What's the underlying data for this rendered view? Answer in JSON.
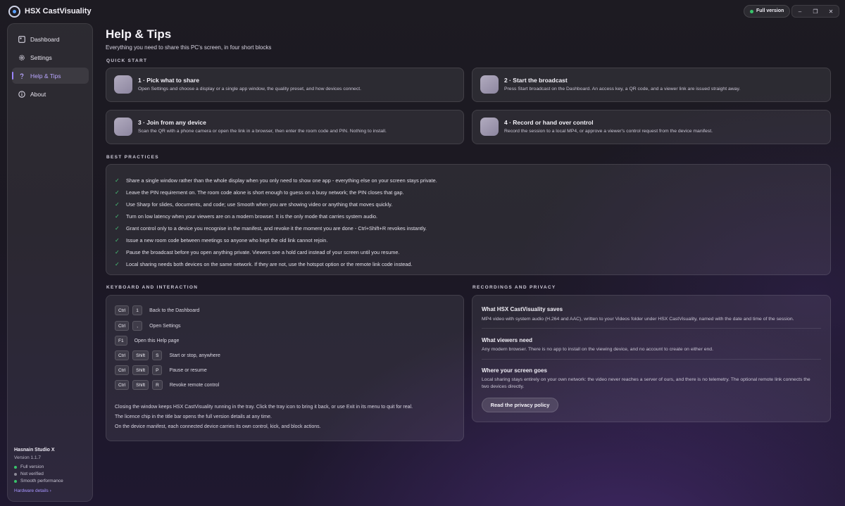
{
  "app": {
    "title": "HSX CastVisuality",
    "license_chip": "Full version"
  },
  "window_controls": {
    "minimize": "–",
    "restore": "❐",
    "close": "✕"
  },
  "sidebar": {
    "items": [
      {
        "label": "Dashboard",
        "icon": "dashboard-icon"
      },
      {
        "label": "Settings",
        "icon": "gear-icon"
      },
      {
        "label": "Help & Tips",
        "icon": "question-icon",
        "active": true
      },
      {
        "label": "About",
        "icon": "info-icon"
      }
    ],
    "footer": {
      "studio": "Hasnain Studio X",
      "version": "Version 1.1.7",
      "statuses": [
        {
          "label": "Full version",
          "color": "#39c46b"
        },
        {
          "label": "Not verified",
          "color": "#8d8a97"
        },
        {
          "label": "Smooth performance",
          "color": "#39c46b"
        }
      ],
      "hardware_link": "Hardware details ›"
    }
  },
  "page": {
    "title": "Help & Tips",
    "subtitle": "Everything you need to share this PC's screen, in four short blocks"
  },
  "quick_start": {
    "label": "QUICK START",
    "steps": [
      {
        "title": "1 · Pick what to share",
        "desc": "Open Settings and choose a display or a single app window, the quality preset, and how devices connect."
      },
      {
        "title": "2 · Start the broadcast",
        "desc": "Press Start broadcast on the Dashboard. An access key, a QR code, and a viewer link are issued straight away."
      },
      {
        "title": "3 · Join from any device",
        "desc": "Scan the QR with a phone camera or open the link in a browser, then enter the room code and PIN. Nothing to install."
      },
      {
        "title": "4 · Record or hand over control",
        "desc": "Record the session to a local MP4, or approve a viewer's control request from the device manifest."
      }
    ]
  },
  "best_practices": {
    "label": "BEST PRACTICES",
    "items": [
      "Share a single window rather than the whole display when you only need to show one app - everything else on your screen stays private.",
      "Leave the PIN requirement on. The room code alone is short enough to guess on a busy network; the PIN closes that gap.",
      "Use Sharp for slides, documents, and code; use Smooth when you are showing video or anything that moves quickly.",
      "Turn on low latency when your viewers are on a modern browser. It is the only mode that carries system audio.",
      "Grant control only to a device you recognise in the manifest, and revoke it the moment you are done - Ctrl+Shift+R revokes instantly.",
      "Issue a new room code between meetings so anyone who kept the old link cannot rejoin.",
      "Pause the broadcast before you open anything private. Viewers see a hold card instead of your screen until you resume.",
      "Local sharing needs both devices on the same network. If they are not, use the hotspot option or the remote link code instead."
    ]
  },
  "keyboard": {
    "label": "KEYBOARD AND INTERACTION",
    "shortcuts": [
      {
        "keys": [
          "Ctrl",
          "1"
        ],
        "action": "Back to the Dashboard"
      },
      {
        "keys": [
          "Ctrl",
          ","
        ],
        "action": "Open Settings"
      },
      {
        "keys": [
          "F1"
        ],
        "action": "Open this Help page"
      },
      {
        "keys": [
          "Ctrl",
          "Shift",
          "S"
        ],
        "action": "Start or stop, anywhere"
      },
      {
        "keys": [
          "Ctrl",
          "Shift",
          "P"
        ],
        "action": "Pause or resume"
      },
      {
        "keys": [
          "Ctrl",
          "Shift",
          "R"
        ],
        "action": "Revoke remote control"
      }
    ],
    "notes": [
      "Closing the window keeps HSX CastVisuality running in the tray. Click the tray icon to bring it back, or use Exit in its menu to quit for real.",
      "The licence chip in the title bar opens the full version details at any time.",
      "On the device manifest, each connected device carries its own control, kick, and block actions."
    ]
  },
  "recordings": {
    "label": "RECORDINGS AND PRIVACY",
    "sections": [
      {
        "title": "What HSX CastVisuality saves",
        "desc": "MP4 video with system audio (H.264 and AAC), written to your Videos folder under HSX CastVisuality, named with the date and time of the session."
      },
      {
        "title": "What viewers need",
        "desc": "Any modern browser. There is no app to install on the viewing device, and no account to create on either end."
      },
      {
        "title": "Where your screen goes",
        "desc": "Local sharing stays entirely on your own network: the video never reaches a server of ours, and there is no telemetry. The optional remote link connects the two devices directly."
      }
    ],
    "button": "Read the privacy policy"
  }
}
